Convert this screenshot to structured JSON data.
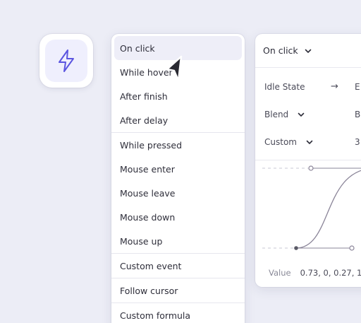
{
  "trigger_icon": {
    "name": "lightning-bolt-icon",
    "color": "#5b55e0"
  },
  "menu": {
    "groups": [
      [
        {
          "label": "On click",
          "active": true
        },
        {
          "label": "While hover",
          "active": false
        },
        {
          "label": "After finish",
          "active": false
        },
        {
          "label": "After delay",
          "active": false
        }
      ],
      [
        {
          "label": "While pressed",
          "active": false
        },
        {
          "label": "Mouse enter",
          "active": false
        },
        {
          "label": "Mouse leave",
          "active": false
        },
        {
          "label": "Mouse down",
          "active": false
        },
        {
          "label": "Mouse up",
          "active": false
        }
      ],
      [
        {
          "label": "Custom event",
          "active": false
        }
      ],
      [
        {
          "label": "Follow cursor",
          "active": false
        }
      ],
      [
        {
          "label": "Custom formula",
          "active": false
        }
      ]
    ]
  },
  "panel": {
    "trigger_select": "On click",
    "state_row": {
      "label": "Idle State",
      "arrow": "→",
      "value": "E"
    },
    "blend_row": {
      "label": "Blend",
      "value": "B"
    },
    "easing_row": {
      "label": "Custom",
      "value": "3"
    },
    "value_row": {
      "label": "Value",
      "value": "0.73, 0, 0.27, 1"
    }
  },
  "colors": {
    "accent": "#5b55e0",
    "background": "#ecedf6",
    "curve": "#8a8498"
  }
}
